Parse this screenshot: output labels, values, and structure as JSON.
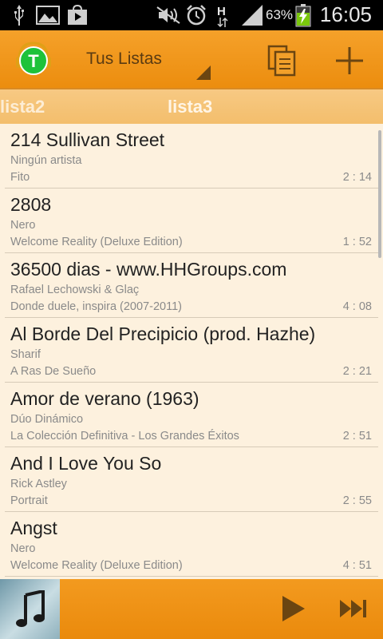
{
  "status_bar": {
    "battery": "63%",
    "network": "H",
    "time": "16:05",
    "icons": [
      "usb-icon",
      "image-icon",
      "store-icon",
      "mute-icon",
      "alarm-icon",
      "signal-icon",
      "battery-icon"
    ]
  },
  "action_bar": {
    "logo_letter": "T",
    "title": "Tus Listas",
    "icons": [
      "copy-icon",
      "add-icon"
    ]
  },
  "tabs": [
    {
      "label": "lista2",
      "active": false
    },
    {
      "label": "lista3",
      "active": true
    }
  ],
  "songs": [
    {
      "title": "214 Sullivan Street",
      "artist": "Ningún artista",
      "album": "Fito",
      "duration": "2 : 14"
    },
    {
      "title": "2808",
      "artist": "Nero",
      "album": "Welcome Reality (Deluxe Edition)",
      "duration": "1 : 52"
    },
    {
      "title": "36500 dias - www.HHGroups.com",
      "artist": "Rafael Lechowski & Glaç",
      "album": "Donde duele, inspira (2007-2011)",
      "duration": "4 : 08"
    },
    {
      "title": "Al Borde Del Precipicio (prod. Hazhe)",
      "artist": "Sharif",
      "album": "A Ras De Sueño",
      "duration": "2 : 21"
    },
    {
      "title": "Amor de verano (1963)",
      "artist": "Dúo Dinámico",
      "album": "La Colección Definitiva - Los Grandes Éxitos",
      "duration": "2 : 51"
    },
    {
      "title": "And I Love You So",
      "artist": "Rick Astley",
      "album": "Portrait",
      "duration": "2 : 55"
    },
    {
      "title": "Angst",
      "artist": "Nero",
      "album": "Welcome Reality (Deluxe Edition)",
      "duration": "4 : 51"
    }
  ],
  "player": {
    "icons": [
      "music-note-icon",
      "play-icon",
      "skip-next-icon"
    ]
  },
  "colors": {
    "accent": "#ec8d0e",
    "list_background": "#fdf1de",
    "tab_background": "#f3be6c"
  }
}
